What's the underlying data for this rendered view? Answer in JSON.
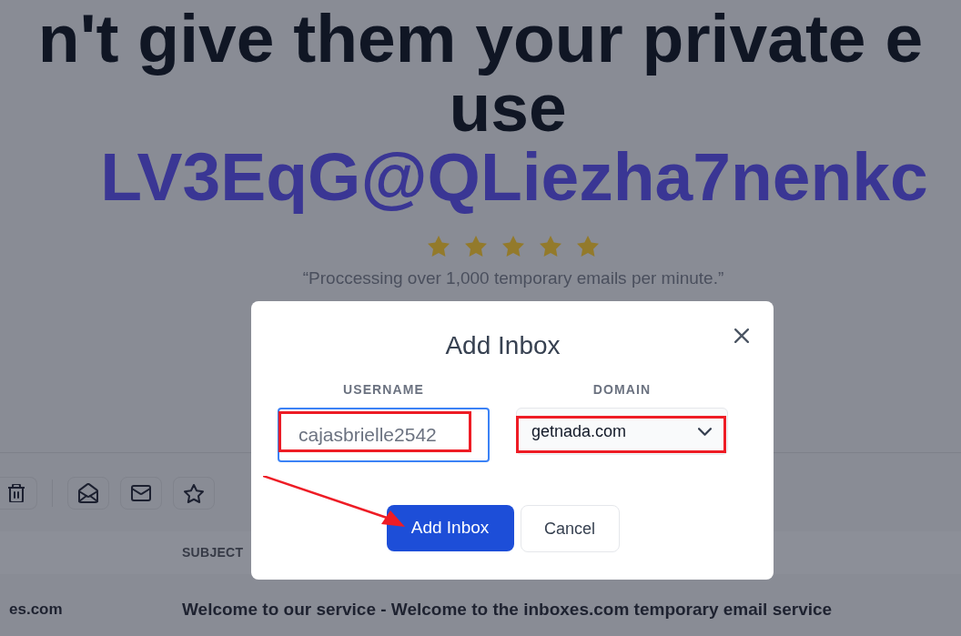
{
  "hero": {
    "heading_lines": [
      "n't give them your private e",
      "use"
    ],
    "email": "LV3EqG@QLiezha7nenkc",
    "rating": {
      "stars": 5
    },
    "quote": "“Proccessing over 1,000 temporary emails per minute.”"
  },
  "table": {
    "subject_header": "SUBJECT",
    "rows": [
      {
        "column_1": "es.com",
        "subject": "Welcome to our service - Welcome to the inboxes.com temporary email service"
      }
    ]
  },
  "dialog": {
    "title": "Add Inbox",
    "fields": [
      {
        "kind": "input",
        "label": "USERNAME",
        "value": "cajasbrielle2542",
        "focused": true
      },
      {
        "kind": "select",
        "label": "DOMAIN",
        "value": "getnada.com",
        "focused": false
      }
    ],
    "buttons": [
      {
        "kind": "primary",
        "label": "Add Inbox"
      },
      {
        "kind": "secondary",
        "label": "Cancel"
      }
    ]
  }
}
